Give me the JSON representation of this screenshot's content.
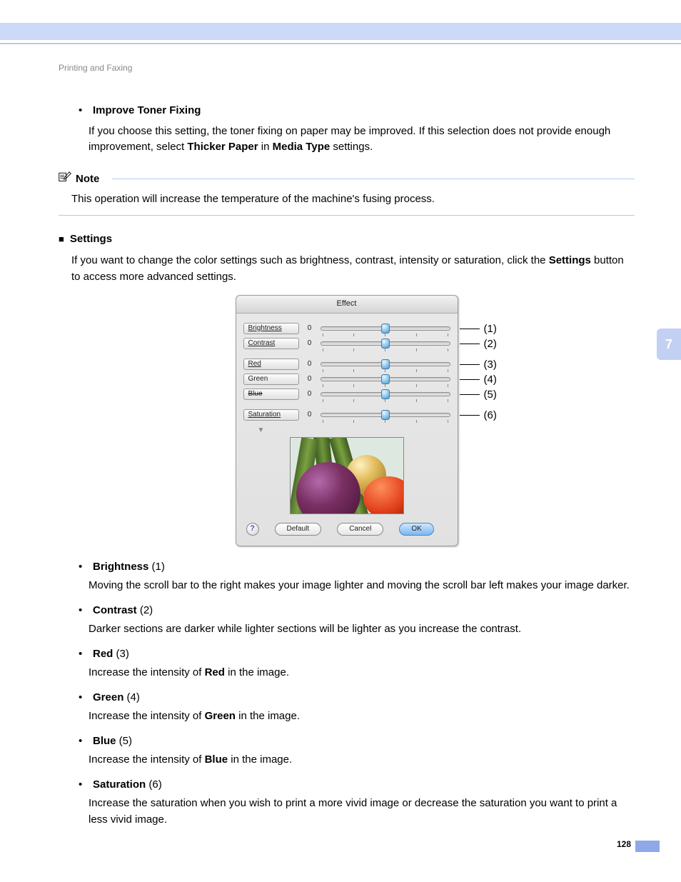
{
  "breadcrumb": "Printing and Faxing",
  "side_tab": "7",
  "page_number": "128",
  "section_improve": {
    "heading": "Improve Toner Fixing",
    "body_a": "If you choose this setting, the toner fixing on paper may be improved. If this selection does not provide enough improvement, select ",
    "bold_b": "Thicker Paper",
    "body_c": " in ",
    "bold_d": "Media Type",
    "body_e": " settings."
  },
  "note": {
    "label": "Note",
    "body": "This operation will increase the temperature of the machine's fusing process."
  },
  "section_settings": {
    "heading": "Settings",
    "body_a": "If you want to change the color settings such as brightness, contrast, intensity or saturation, click  the ",
    "bold_b": "Settings",
    "body_c": " button to access more advanced settings."
  },
  "dialog": {
    "title": "Effect",
    "sliders": [
      {
        "label": "Brightness",
        "value": "0",
        "ul": true
      },
      {
        "label": "Contrast",
        "value": "0",
        "ul": true
      },
      {
        "label": "Red",
        "value": "0",
        "ul": true
      },
      {
        "label": "Green",
        "value": "0"
      },
      {
        "label": "Blue",
        "value": "0",
        "strike": true
      },
      {
        "label": "Saturation",
        "value": "0",
        "ul": true
      }
    ],
    "buttons": {
      "default": "Default",
      "cancel": "Cancel",
      "ok": "OK"
    }
  },
  "callouts": [
    "(1)",
    "(2)",
    "(3)",
    "(4)",
    "(5)",
    "(6)"
  ],
  "items": [
    {
      "name": "Brightness",
      "num": " (1)",
      "body_a": "Moving the scroll bar to the right makes your image lighter and moving the scroll bar left makes your image darker."
    },
    {
      "name": "Contrast",
      "num": " (2)",
      "body_a": "Darker sections are darker while lighter sections will be lighter as you increase the contrast."
    },
    {
      "name": "Red",
      "num": " (3)",
      "body_a": "Increase the intensity of ",
      "bold_b": "Red",
      "body_c": " in the image."
    },
    {
      "name": "Green",
      "num": " (4)",
      "body_a": "Increase the intensity of ",
      "bold_b": "Green",
      "body_c": " in the image."
    },
    {
      "name": "Blue",
      "num": " (5)",
      "body_a": "Increase the intensity of ",
      "bold_b": "Blue",
      "body_c": " in the image."
    },
    {
      "name": "Saturation",
      "num": " (6)",
      "body_a": "Increase the saturation when you wish to print a more vivid image or decrease the saturation you want to print a less vivid image."
    }
  ]
}
